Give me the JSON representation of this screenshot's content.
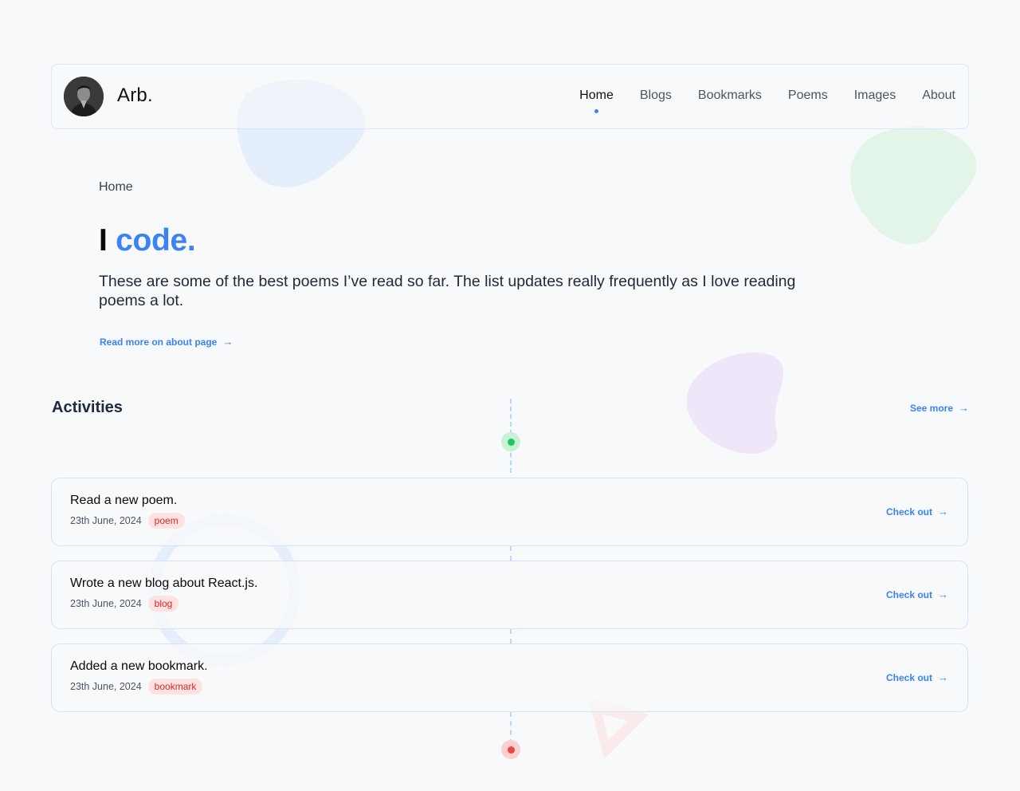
{
  "header": {
    "brand": "Arb.",
    "nav": [
      {
        "label": "Home",
        "active": true
      },
      {
        "label": "Blogs",
        "active": false
      },
      {
        "label": "Bookmarks",
        "active": false
      },
      {
        "label": "Poems",
        "active": false
      },
      {
        "label": "Images",
        "active": false
      },
      {
        "label": "About",
        "active": false
      }
    ]
  },
  "hero": {
    "breadcrumb": "Home",
    "title_prefix": "I",
    "title_accent": "code.",
    "description": "These are some of the best poems I’ve read so far. The list updates really frequently as I love reading poems a lot.",
    "read_more": "Read more on about page"
  },
  "activities": {
    "title": "Activities",
    "see_more": "See more",
    "items": [
      {
        "title": "Read a new poem.",
        "date": "23th June, 2024",
        "tag": "poem",
        "link": "Check out"
      },
      {
        "title": "Wrote a new blog about React.js.",
        "date": "23th June, 2024",
        "tag": "blog",
        "link": "Check out"
      },
      {
        "title": "Added a new bookmark.",
        "date": "23th June, 2024",
        "tag": "bookmark",
        "link": "Check out"
      }
    ]
  },
  "icons": {
    "arrow": "arrow-right-icon",
    "timeline_start": "timeline-dot-green",
    "timeline_end": "timeline-dot-red"
  },
  "colors": {
    "accent": "#3b82f6",
    "tag_text": "#dc2626",
    "tag_bg": "#fde2e2",
    "dot_green": "#22c55e",
    "dot_red": "#ef4444"
  }
}
